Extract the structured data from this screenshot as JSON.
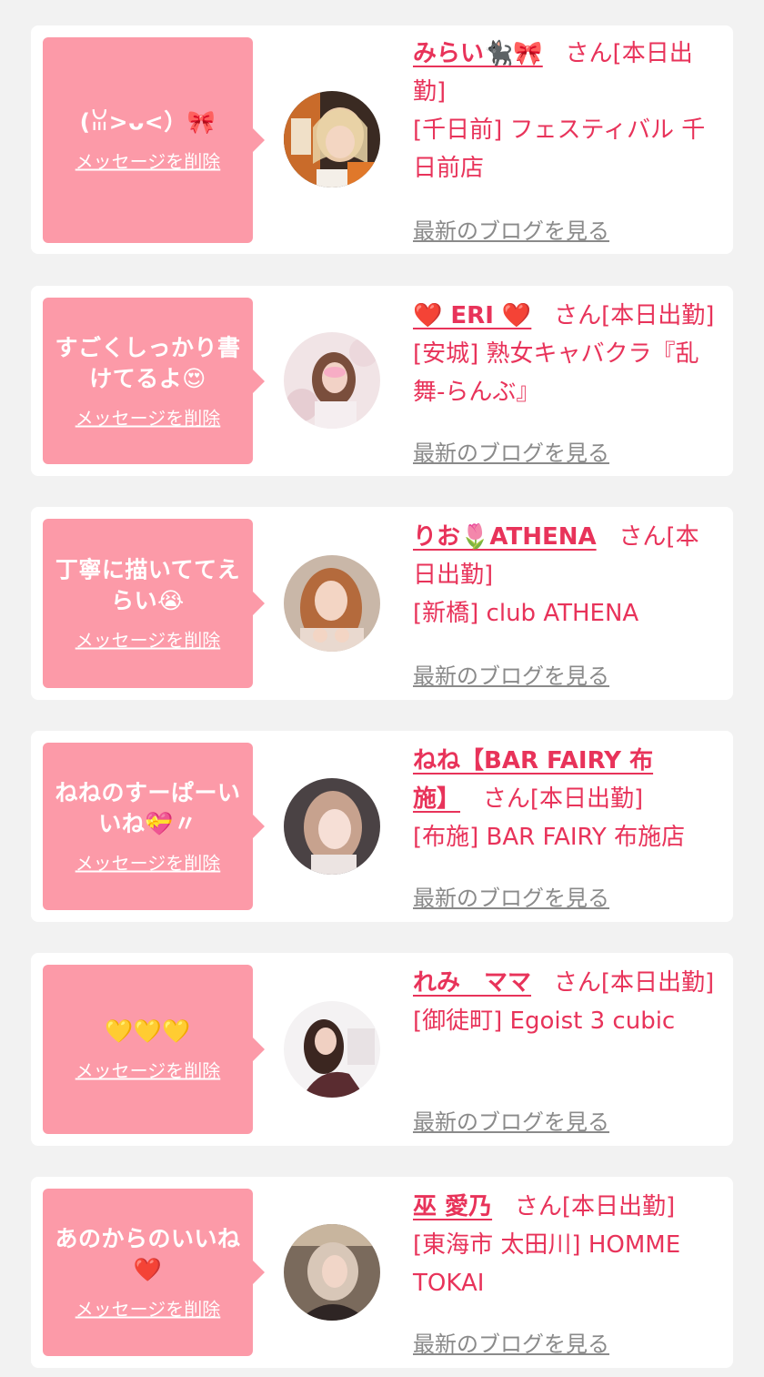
{
  "entries": [
    {
      "message": "(ꈍ>ᴗ<）🎀",
      "delete_label": "メッセージを削除",
      "name": "みらい🐈‍⬛🎀",
      "san": "さん[本日出勤]",
      "shop": "[千日前] フェスティバル 千日前店",
      "blog_label": "最新のブログを見る"
    },
    {
      "message": "すごくしっかり書けてるよ😍",
      "delete_label": "メッセージを削除",
      "name": "❤️ ERI ❤️",
      "san": "さん[本日出勤]",
      "shop": "[安城] 熟女キャバクラ『乱舞-らんぶ』",
      "blog_label": "最新のブログを見る"
    },
    {
      "message": "丁寧に描いててえらい😭",
      "delete_label": "メッセージを削除",
      "name": "りお🌷ATHENA",
      "san": "さん[本日出勤]",
      "shop": "[新橋] club ATHENA",
      "blog_label": "最新のブログを見る"
    },
    {
      "message": "ねねのすーぱーいいね💝〃",
      "delete_label": "メッセージを削除",
      "name": "ねね【BAR FAIRY 布施】",
      "san": "さん[本日出勤]",
      "shop": "[布施] BAR FAIRY 布施店",
      "blog_label": "最新のブログを見る"
    },
    {
      "message": "💛💛💛",
      "delete_label": "メッセージを削除",
      "name": "れみ　ママ",
      "san": "さん[本日出勤]",
      "shop": "[御徒町] Egoist 3 cubic",
      "blog_label": "最新のブログを見る"
    },
    {
      "message": "あのからのいいね❤️",
      "delete_label": "メッセージを削除",
      "name": "巫 愛乃",
      "san": "さん[本日出勤]",
      "shop": "[東海市 太田川] HOMME TOKAI",
      "blog_label": "最新のブログを見る"
    }
  ],
  "colors": {
    "background": "#f2f2f2",
    "card": "#ffffff",
    "bubble": "#fc9aa8",
    "accent": "#e8335a",
    "link_gray": "#8a8a8a"
  },
  "avatar_labels": [
    "avatar",
    "avatar",
    "avatar",
    "avatar",
    "avatar",
    "avatar"
  ]
}
